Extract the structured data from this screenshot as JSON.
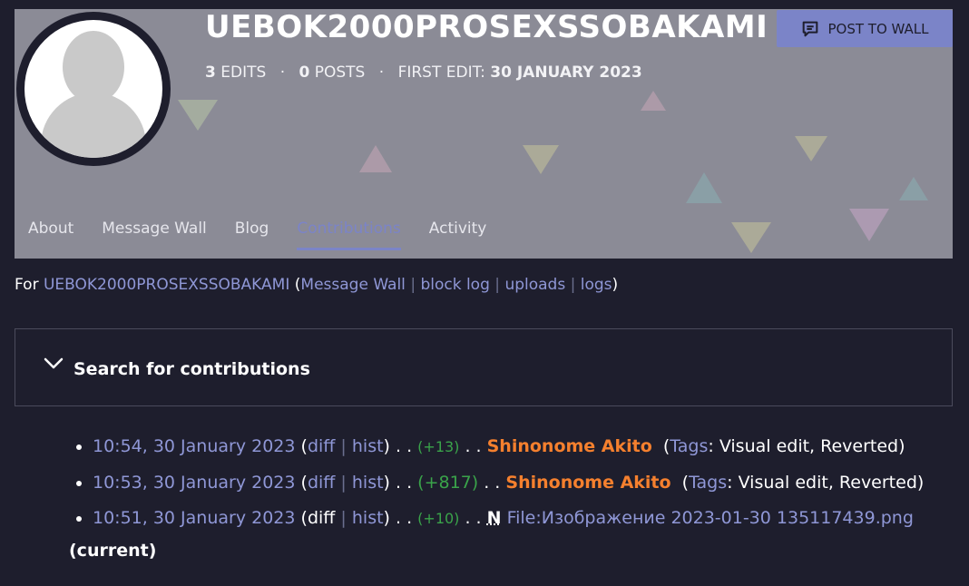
{
  "header": {
    "username": "UEBOK2000PROSEXSSOBAKAMI",
    "stats": {
      "edits_count": "3",
      "edits_label": "EDITS",
      "posts_count": "0",
      "posts_label": "POSTS",
      "first_edit_label": "FIRST EDIT:",
      "first_edit_date": "30 JANUARY 2023"
    },
    "post_button_label": "POST TO WALL"
  },
  "tabs": [
    {
      "label": "About",
      "active": false
    },
    {
      "label": "Message Wall",
      "active": false
    },
    {
      "label": "Blog",
      "active": false
    },
    {
      "label": "Contributions",
      "active": true
    },
    {
      "label": "Activity",
      "active": false
    }
  ],
  "for_line": {
    "prefix": "For",
    "user_link": "UEBOK2000PROSEXSSOBAKAMI",
    "links": [
      "Message Wall",
      "block log",
      "uploads",
      "logs"
    ]
  },
  "search": {
    "title": "Search for contributions"
  },
  "contributions": [
    {
      "timestamp": "10:54, 30 January 2023",
      "diff": "diff",
      "hist": "hist",
      "size": "(+13)",
      "page": "Shinonome Akito",
      "tags_label": "Tags",
      "tags": ": Visual edit, Reverted)"
    },
    {
      "timestamp": "10:53, 30 January 2023",
      "diff": "diff",
      "hist": "hist",
      "size": "(+817)",
      "page": "Shinonome Akito",
      "tags_label": "Tags",
      "tags": ": Visual edit, Reverted)"
    },
    {
      "timestamp": "10:51, 30 January 2023",
      "diff": "diff",
      "hist": "hist",
      "size": "(+10)",
      "new_flag": "N",
      "page": "File:Изображение 2023-01-30 135117439.png",
      "current": "(current)"
    }
  ],
  "colors": {
    "background": "#1e1e2d",
    "accent": "#7b84c8",
    "link": "#8f97d6",
    "positive": "#3aa34a",
    "page_link": "#f5802e"
  },
  "icons": {
    "post_button": "speech-bubble-icon",
    "search_toggle": "chevron-down-icon",
    "avatar": "user-silhouette-icon"
  }
}
